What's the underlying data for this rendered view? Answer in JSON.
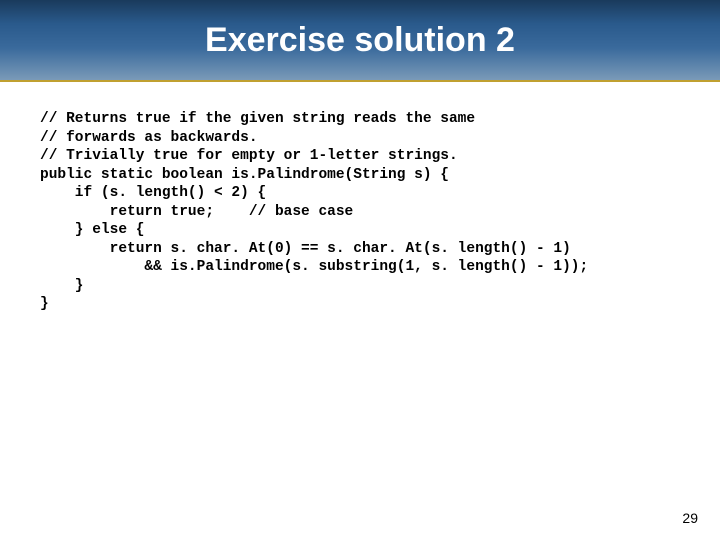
{
  "header": {
    "title": "Exercise solution 2"
  },
  "code": {
    "line1": "// Returns true if the given string reads the same",
    "line2": "// forwards as backwards.",
    "line3": "// Trivially true for empty or 1-letter strings.",
    "line4": "public static boolean is.Palindrome(String s) {",
    "line5": "    if (s. length() < 2) {",
    "line6": "        return true;    // base case",
    "line7": "    } else {",
    "line8": "        return s. char. At(0) == s. char. At(s. length() - 1)",
    "line9": "            && is.Palindrome(s. substring(1, s. length() - 1));",
    "line10": "    }",
    "line11": "}"
  },
  "footer": {
    "page_number": "29"
  }
}
